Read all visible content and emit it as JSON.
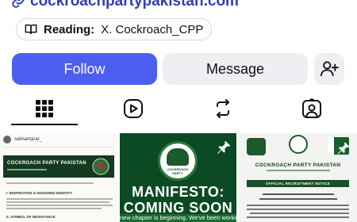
{
  "profile": {
    "link_text": "cockroachpartypakistan.com",
    "reading_label": "Reading:",
    "reading_value": "X. Cockroach_CPP"
  },
  "actions": {
    "follow_label": "Follow",
    "message_label": "Message"
  },
  "tabs": [
    {
      "icon": "grid-icon",
      "active": true
    },
    {
      "icon": "reels-icon",
      "active": false
    },
    {
      "icon": "repost-icon",
      "active": false
    },
    {
      "icon": "tagged-icon",
      "active": false
    }
  ],
  "posts": {
    "post1": {
      "username": "salmantarar_",
      "banner_title": "COCKROACH PARTY PAKISTAN",
      "section1": "I. INSPIRATION & DESIGNED IDENTITY",
      "section2": "II. SYMBOL OF RESISTANCE"
    },
    "post2": {
      "logo_text": "COCKROACH PARTY",
      "headline1": "MANIFESTO:",
      "headline2": "COMING SOON",
      "caption": "new chapter is beginning. We've been working o"
    },
    "post3": {
      "heading": "COCKROACH PARTY PAKISTAN",
      "notice": "OFFICIAL RECRUITMENT NOTICE"
    }
  },
  "colors": {
    "link": "#2f3fb8",
    "follow_bg": "#4d5ef1",
    "secondary_bg": "#eeeff3",
    "party_green": "#0c4a23"
  }
}
